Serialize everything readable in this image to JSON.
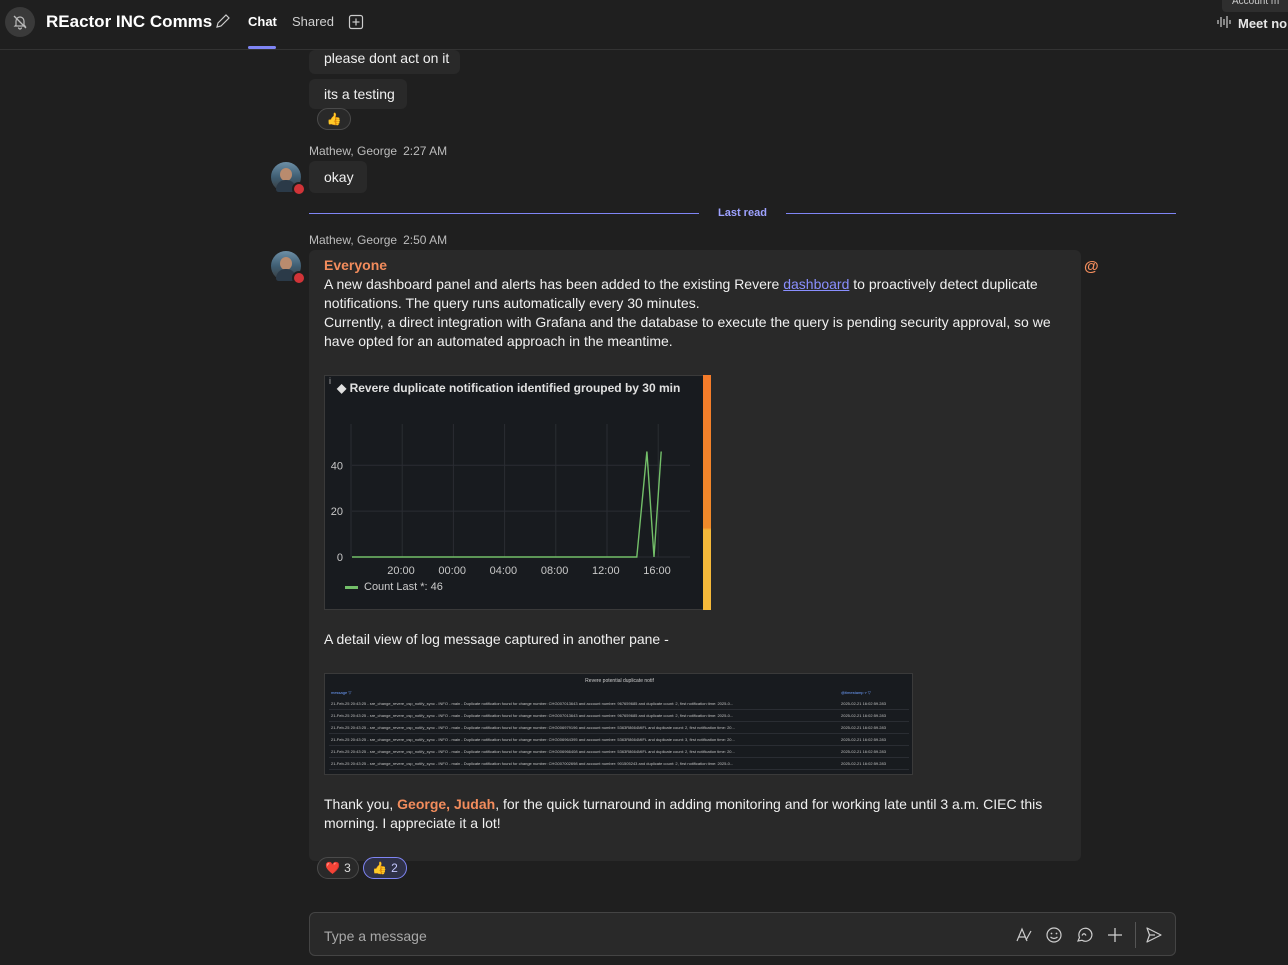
{
  "header": {
    "title": "REactor INC Comms",
    "tabs": [
      {
        "label": "Chat",
        "active": true
      },
      {
        "label": "Shared",
        "active": false
      }
    ],
    "meet_label": "Meet no",
    "account_chip": "Account m"
  },
  "messages": {
    "m1": {
      "text": "please dont act on it"
    },
    "m2": {
      "text": "its a testing",
      "reaction_emoji": "👍"
    },
    "m3": {
      "author": "Mathew, George",
      "time": "2:27 AM",
      "text": "okay"
    },
    "last_read": "Last read",
    "m4": {
      "author": "Mathew, George",
      "time": "2:50 AM",
      "mention": "Everyone",
      "p1_before": "A new dashboard panel and alerts has been added to the existing Revere ",
      "p1_link": "dashboard",
      "p1_after": " to proactively detect duplicate notifications. The query runs automatically every 30 minutes.",
      "p2": "Currently, a direct integration with Grafana and the database to execute the query is pending security approval, so we have opted for an automated approach in the meantime.",
      "p3": "A detail view of log message captured in another pane -",
      "p4_before": "Thank you, ",
      "p4_mention": "George, Judah",
      "p4_after": ", for the quick turnaround in adding monitoring and for working late until 3 a.m. CIEC this morning. I appreciate it a lot!",
      "reactions": [
        {
          "emoji": "❤️",
          "count": "3"
        },
        {
          "emoji": "👍",
          "count": "2"
        }
      ]
    }
  },
  "chart_data": {
    "type": "line",
    "title": "Revere duplicate notification identified grouped by 30 min",
    "x_ticks": [
      "20:00",
      "00:00",
      "04:00",
      "08:00",
      "12:00",
      "16:00"
    ],
    "y_ticks": [
      "0",
      "20",
      "40"
    ],
    "ylim": [
      0,
      58
    ],
    "x_range": [
      16.5,
      17.8
    ],
    "grid": true,
    "series": [
      {
        "name": "Count",
        "legend": "Count  Last *: 46",
        "color": "#73bf69",
        "points": [
          [
            16.5,
            0
          ],
          [
            36.3,
            0
          ],
          [
            37.0,
            46
          ],
          [
            37.5,
            0
          ],
          [
            38.0,
            46
          ]
        ]
      }
    ]
  },
  "log_table": {
    "title": "Revere potential duplicate notif",
    "col_message": "message ▽",
    "col_timestamp": "@timestamp ▿ ▽",
    "rows": [
      {
        "message": "21-Feb-25 20:43:25 - sre_change_revere_csp_notify_sync - INFO - main - Duplicate notification found for change number: CHG007013643 and account number: 967659685 and duplicate count: 2, first notification time: 2025-0...",
        "ts": "2025-02-21 16:02:59.283"
      },
      {
        "message": "21-Feb-25 20:43:25 - sre_change_revere_csp_notify_sync - INFO - main - Duplicate notification found for change number: CHG007013643 and account number: 967659685 and duplicate count: 2, first notification time: 2025-0...",
        "ts": "2025-02-21 16:02:59.283"
      },
      {
        "message": "21-Feb-25 20:43:25 - sre_change_revere_csp_notify_sync - INFO - main - Duplicate notification found for change number: CHG006979196 and account number: 5363R8664MIFL and duplicate count: 2, first notification time: 20...",
        "ts": "2025-02-21 16:02:59.283"
      },
      {
        "message": "21-Feb-25 20:43:25 - sre_change_revere_csp_notify_sync - INFO - main - Duplicate notification found for change number: CHG006964395 and account number: 5363R8664MIFL and duplicate count: 3, first notification time: 20...",
        "ts": "2025-02-21 16:02:59.283"
      },
      {
        "message": "21-Feb-25 20:43:25 - sre_change_revere_csp_notify_sync - INFO - main - Duplicate notification found for change number: CHG006966408 and account number: 5363R8664MIFL and duplicate count: 2, first notification time: 20...",
        "ts": "2025-02-21 16:02:59.283"
      },
      {
        "message": "21-Feb-25 20:43:25 - sre_change_revere_csp_notify_sync - INFO - main - Duplicate notification found for change number: CHG007002698 and account number: 901505243 and duplicate count: 2, first notification time: 2025-0...",
        "ts": "2025-02-21 16:02:59.283"
      }
    ]
  },
  "compose": {
    "placeholder": "Type a message"
  },
  "colors": {
    "accent": "#7f85f5",
    "mention": "#f28c5c",
    "presence_busy": "#d13438"
  },
  "icons": [
    "bell-off-icon",
    "pencil-icon",
    "add-tab-icon",
    "audio-waveform-icon",
    "format-icon",
    "emoji-icon",
    "loop-icon",
    "plus-icon",
    "send-icon",
    "at-mention-icon"
  ]
}
